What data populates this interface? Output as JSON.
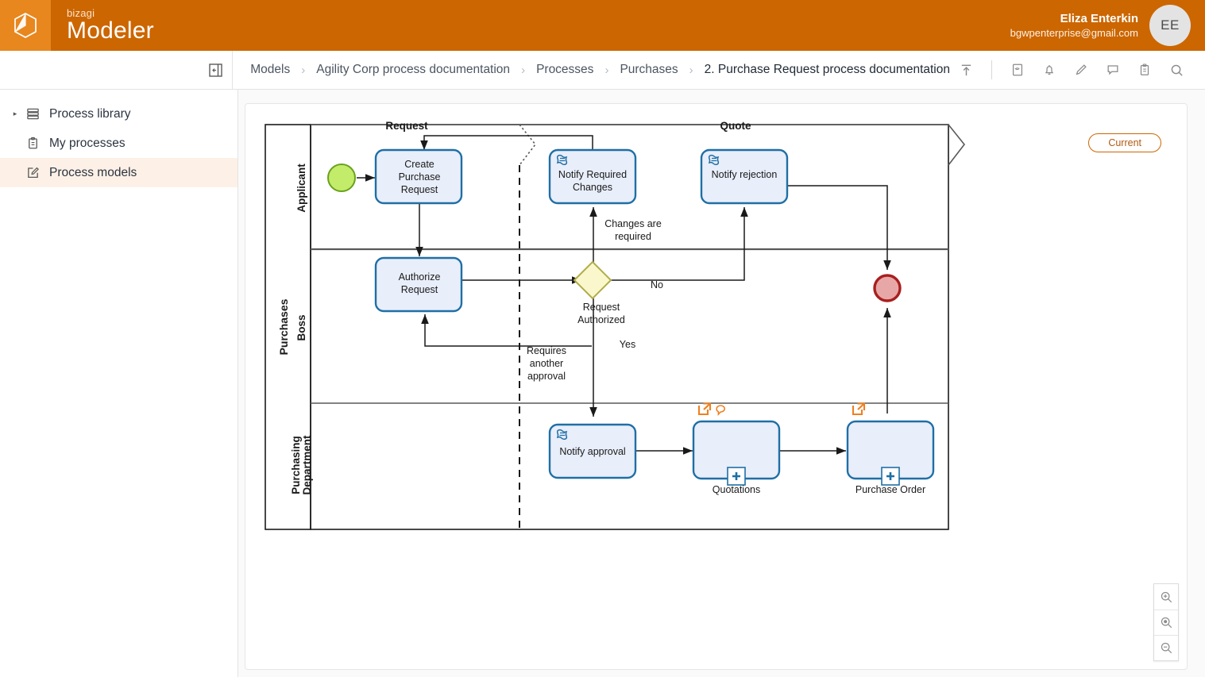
{
  "header": {
    "brand_small": "bizagi",
    "brand_big": "Modeler",
    "logo_icon": "cube-logo-icon",
    "user": {
      "name": "Eliza Enterkin",
      "email": "bgwpenterprise@gmail.com",
      "initials": "EE"
    }
  },
  "crumb_bar": {
    "panel_toggle_icon": "collapse-panel-icon",
    "breadcrumbs": [
      {
        "label": "Models"
      },
      {
        "label": "Agility Corp process documentation"
      },
      {
        "label": "Processes"
      },
      {
        "label": "Purchases"
      },
      {
        "label": "2. Purchase Request process documentation"
      }
    ],
    "separator": "›",
    "tools": [
      {
        "name": "export-upload-icon"
      },
      {
        "name": "document-icon"
      },
      {
        "name": "bell-icon"
      },
      {
        "name": "pencil-icon"
      },
      {
        "name": "comment-icon"
      },
      {
        "name": "clipboard-icon"
      },
      {
        "name": "search-icon"
      }
    ]
  },
  "sidebar": {
    "items": [
      {
        "label": "Process library",
        "icon": "library-icon",
        "caret": "▸",
        "selected": false
      },
      {
        "label": "My processes",
        "icon": "clipboard-icon",
        "caret": "",
        "selected": false
      },
      {
        "label": "Process models",
        "icon": "edit-document-icon",
        "caret": "",
        "selected": true
      }
    ]
  },
  "canvas": {
    "badge_current": "Current",
    "zoom_controls": [
      {
        "name": "zoom-in-icon"
      },
      {
        "name": "zoom-reset-icon"
      },
      {
        "name": "zoom-out-icon"
      }
    ]
  },
  "diagram": {
    "pool_label": "Purchases",
    "lanes": [
      {
        "label": "Applicant"
      },
      {
        "label": "Boss"
      },
      {
        "label": "Purchasing\nDepartment",
        "line1": "Purchasing",
        "line2": "Department"
      }
    ],
    "phases": [
      {
        "label": "Request"
      },
      {
        "label": "Quote"
      }
    ],
    "events": [
      {
        "name": "start-event",
        "type": "start",
        "lane": "Applicant"
      },
      {
        "name": "end-event",
        "type": "end",
        "lane": "Boss"
      }
    ],
    "tasks": [
      {
        "id": "create-purchase-request",
        "label": "Create\nPurchase\nRequest",
        "lines": [
          "Create",
          "Purchase",
          "Request"
        ],
        "lane": "Applicant",
        "marker": "none"
      },
      {
        "id": "notify-required-changes",
        "label": "Notify Required\nChanges",
        "lines": [
          "Notify Required",
          "Changes"
        ],
        "lane": "Applicant",
        "marker": "script"
      },
      {
        "id": "notify-rejection",
        "label": "Notify rejection",
        "lines": [
          "Notify rejection"
        ],
        "lane": "Applicant",
        "marker": "script"
      },
      {
        "id": "authorize-request",
        "label": "Authorize\nRequest",
        "lines": [
          "Authorize",
          "Request"
        ],
        "lane": "Boss",
        "marker": "none"
      },
      {
        "id": "notify-approval",
        "label": "Notify approval",
        "lines": [
          "Notify approval"
        ],
        "lane": "Purchasing Department",
        "marker": "script"
      }
    ],
    "subprocesses": [
      {
        "id": "quotations",
        "label": "Quotations",
        "lane": "Purchasing Department",
        "has_link": true,
        "has_comment": true
      },
      {
        "id": "purchase-order",
        "label": "Purchase Order",
        "lane": "Purchasing Department",
        "has_link": true,
        "has_comment": false
      }
    ],
    "gateways": [
      {
        "id": "request-authorized",
        "label": "Request\nAuthorized",
        "lines": [
          "Request",
          "Authorized"
        ],
        "type": "exclusive",
        "lane": "Boss"
      }
    ],
    "flow_labels": [
      {
        "id": "changes-required",
        "lines": [
          "Changes are",
          "required"
        ]
      },
      {
        "id": "no-branch",
        "lines": [
          "No"
        ]
      },
      {
        "id": "yes-branch",
        "lines": [
          "Yes"
        ]
      },
      {
        "id": "requires-another-approval",
        "lines": [
          "Requires",
          "another",
          "approval"
        ]
      }
    ]
  },
  "colors": {
    "brand_orange": "#cc6600",
    "logo_tile": "#e8871e",
    "task_fill": "#e8eefa",
    "task_stroke": "#1f6fa5",
    "gateway_fill": "#fbf7cc",
    "gateway_stroke": "#b0ad49",
    "start_fill": "#c2ec69",
    "start_stroke": "#6aa21c",
    "end_fill": "#e8a7a7",
    "end_stroke": "#a81f1f",
    "accent_orange": "#ef8020",
    "sidebar_selected": "#fdf1e7"
  }
}
